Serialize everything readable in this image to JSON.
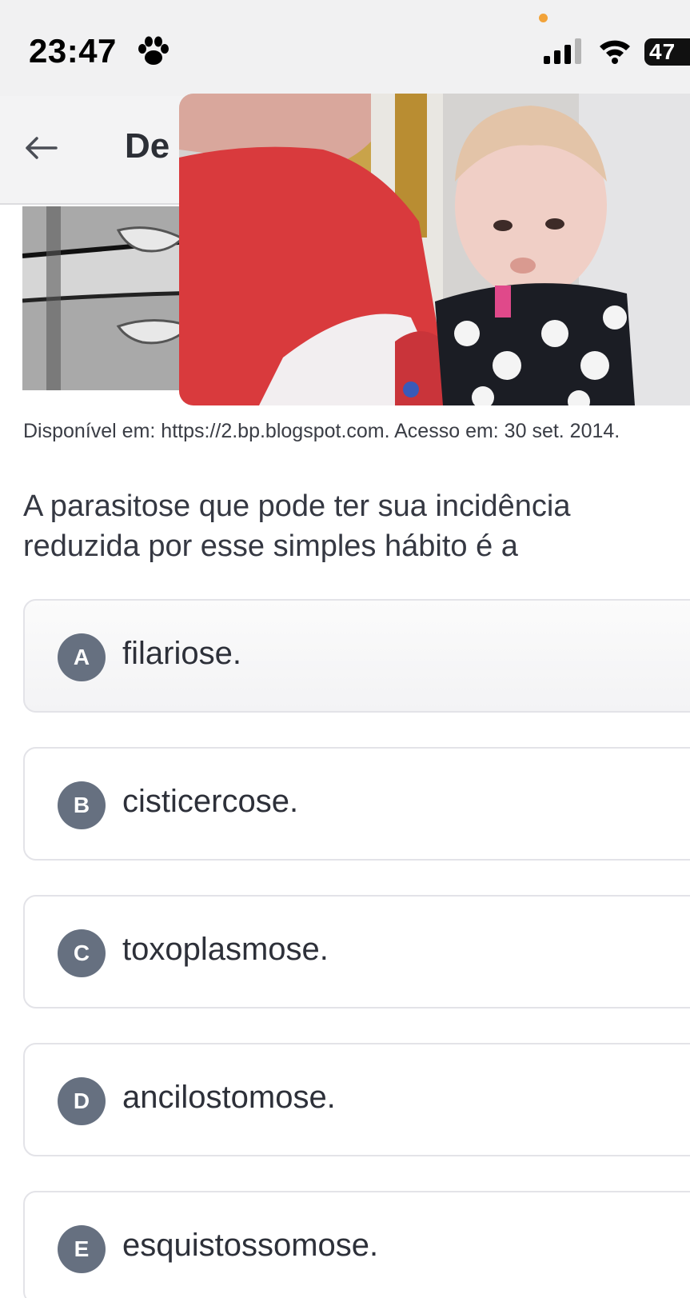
{
  "status_bar": {
    "time": "23:47",
    "battery": "47",
    "icons": [
      "paw-icon",
      "signal-icon",
      "wifi-icon",
      "battery-icon"
    ]
  },
  "header": {
    "title": "De",
    "back_icon": "arrow-left-icon"
  },
  "question": {
    "source": "Disponível em: https://2.bp.blogspot.com. Acesso em: 30 set. 2014.",
    "text": "A parasitose que pode ter sua incidência reduzida por esse simples hábito é a"
  },
  "options": [
    {
      "letter": "A",
      "text": "filariose."
    },
    {
      "letter": "B",
      "text": "cisticercose."
    },
    {
      "letter": "C",
      "text": "toxoplasmose."
    },
    {
      "letter": "D",
      "text": "ancilostomose."
    },
    {
      "letter": "E",
      "text": "esquistossomose."
    }
  ],
  "colors": {
    "badge": "#667080",
    "border": "#e3e3e8",
    "accent_dot": "#f2a33a"
  }
}
